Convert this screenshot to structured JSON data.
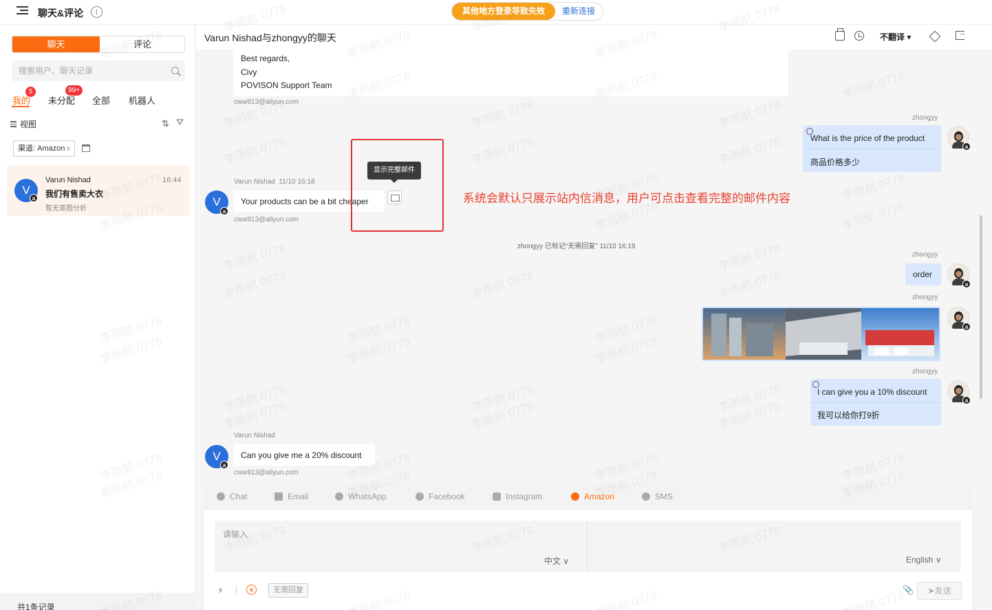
{
  "topbar": {
    "title": "聊天&评论",
    "info_icon": "i",
    "alert_text": "其他地方登录导致失效",
    "reconnect_label": "重新连接"
  },
  "left": {
    "segments": [
      "聊天",
      "评论"
    ],
    "search_placeholder": "搜索用户、聊天记录",
    "filter_tabs": [
      {
        "label": "我的",
        "badge": "5"
      },
      {
        "label": "未分配",
        "badge": "99+"
      },
      {
        "label": "全部"
      },
      {
        "label": "机器人"
      }
    ],
    "view_label": "视图",
    "channel_tag": "渠道: Amazon",
    "channel_tag_close": "x",
    "conversation": {
      "avatar_letter": "V",
      "name": "Varun Nishad",
      "time": "16:44",
      "last_message": "我们有售卖大衣",
      "intent": "暂无意图分析"
    },
    "footer": "共1条记录"
  },
  "header": {
    "title": "Varun Nishad与zhongyy的聊天",
    "translate_label": "不翻译 ▾"
  },
  "chat": {
    "email_tail": {
      "lines": [
        "Best regards,",
        "Civy",
        "POVISON Support Team"
      ],
      "email": "cww913@aliyun.com"
    },
    "msg_price": {
      "sender": "zhongyy",
      "text": "What is the price of the product",
      "translation": "商品价格多少"
    },
    "msg_cheaper": {
      "avatar_letter": "V",
      "sender": "Varun Nishad",
      "time": "11/10 16:18",
      "text": "Your products can be a bit cheaper",
      "email": "cww913@aliyun.com"
    },
    "tooltip": "显示完整邮件",
    "annotation": "系统会默认只展示站内信消息，用户可点击查看完整的邮件内容",
    "system_note": "zhongyy 已标记“无需回复”  11/10 16:19",
    "msg_order": {
      "sender": "zhongyy",
      "text": "order"
    },
    "msg_image": {
      "sender": "zhongyy"
    },
    "msg_discount": {
      "sender": "zhongyy",
      "text": "I can give you a 10% discount",
      "translation": "我可以给你打9折"
    },
    "msg_20": {
      "avatar_letter": "V",
      "sender": "Varun Nishad",
      "text": "Can you give me a 20% discount",
      "email": "cww913@aliyun.com"
    }
  },
  "composer": {
    "channels": [
      "Chat",
      "Email",
      "WhatsApp",
      "Facebook",
      "Instagram",
      "Amazon",
      "SMS"
    ],
    "active_channel": "Amazon",
    "placeholder": "请输入",
    "lang_source": "中文 ∨",
    "lang_target": "English ∨",
    "no_reply_label": "无需回复",
    "send_label": "发送",
    "amazon_glyph": "a"
  },
  "watermark": "李雨航 0778",
  "colors": {
    "accent": "#fb6b10",
    "annotation": "#e8402e",
    "bubble_mine": "#d8e7fd",
    "badge": "#f5323a"
  }
}
